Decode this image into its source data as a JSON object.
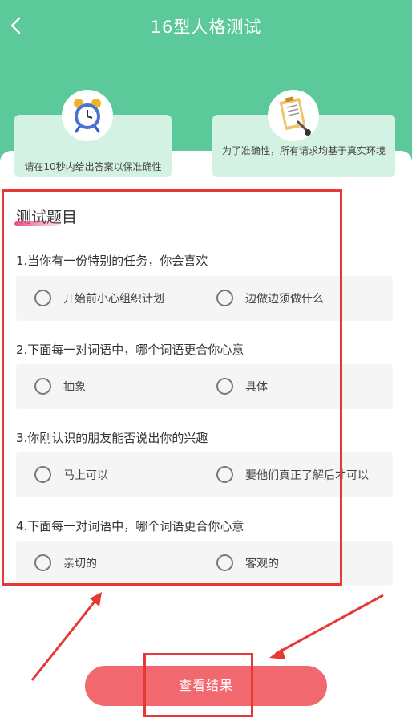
{
  "header": {
    "title": "16型人格测试",
    "back_icon": "chevron-left-icon",
    "background_color": "#5cc99a"
  },
  "info_cards": [
    {
      "icon": "alarm-clock-icon",
      "text": "请在10秒内给出答案以保准确性"
    },
    {
      "icon": "clipboard-icon",
      "text": "为了准确性，所有请求均基于真实环境"
    }
  ],
  "section": {
    "title": "测试题目"
  },
  "questions": [
    {
      "text": "1.当你有一份特别的任务，你会喜欢",
      "options": [
        "开始前小心组织计划",
        "边做边须做什么"
      ]
    },
    {
      "text": "2.下面每一对词语中，哪个词语更合你心意",
      "options": [
        "抽象",
        "具体"
      ]
    },
    {
      "text": "3.你刚认识的朋友能否说出你的兴趣",
      "options": [
        "马上可以",
        "要他们真正了解后才可以"
      ]
    },
    {
      "text": "4.下面每一对词语中，哪个词语更合你心意",
      "options": [
        "亲切的",
        "客观的"
      ]
    }
  ],
  "result_button": {
    "label": "查看结果",
    "color": "#f2686f"
  },
  "annotation_color": "#e53935"
}
